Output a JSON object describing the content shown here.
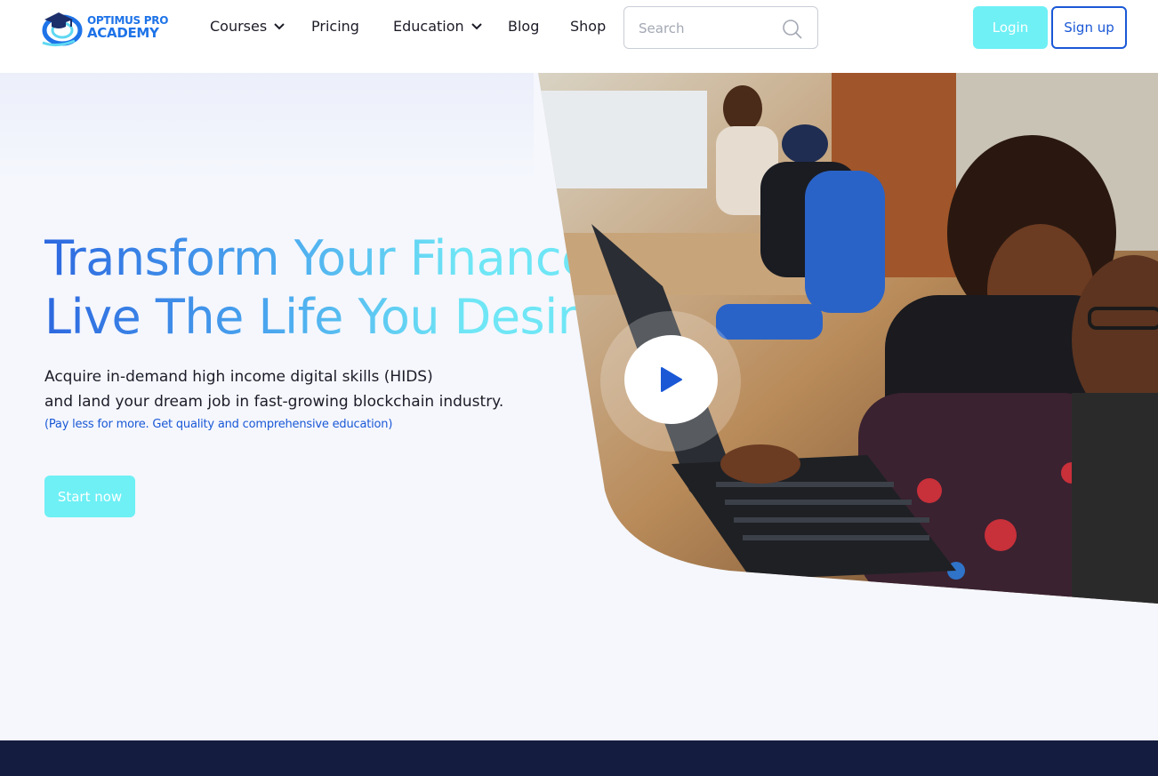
{
  "brand": {
    "name_line1": "OPTIMUS PRO",
    "name_line2": "ACADEMY",
    "logo_icon": "graduation-cap-swirl-icon",
    "color": "#1e73e8"
  },
  "nav": {
    "items": [
      {
        "label": "Courses",
        "dropdown": true
      },
      {
        "label": "Pricing",
        "dropdown": false
      },
      {
        "label": "Education",
        "dropdown": true
      },
      {
        "label": "Blog",
        "dropdown": false
      },
      {
        "label": "Shop",
        "dropdown": false
      }
    ]
  },
  "search": {
    "placeholder": "Search",
    "value": "",
    "icon": "search-icon"
  },
  "auth": {
    "login_label": "Login",
    "signup_label": "Sign up"
  },
  "hero": {
    "title_line1": "Transform Your Finance,",
    "title_line2": "Live The Life You Desire",
    "subtitle_line1": "Acquire in-demand high income digital skills (HIDS)",
    "subtitle_line2": "and land your dream job in fast-growing blockchain industry.",
    "note": "(Pay less for more. Get quality and comprehensive education)",
    "cta_label": "Start now",
    "play_icon": "play-icon"
  },
  "colors": {
    "accent_cyan": "#6ef0f5",
    "accent_blue": "#1a58d6",
    "title_gradient_start": "#2d68e0",
    "title_gradient_end": "#6fe6f5",
    "footer_band": "#141c3f",
    "page_background": "#f5f7fd"
  }
}
